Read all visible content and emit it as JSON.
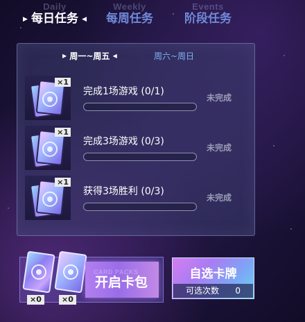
{
  "tabs": {
    "daily": {
      "label": "每日任务",
      "ghost": "Daily"
    },
    "weekly": {
      "label": "每周任务",
      "ghost": "Weekly"
    },
    "stage": {
      "label": "阶段任务",
      "ghost": "Events"
    }
  },
  "subtabs": {
    "weekday": "周一~周五",
    "weekend": "周六~周日"
  },
  "tasks": [
    {
      "name": "完成1场游戏 (0/1)",
      "reward_count": "×1",
      "status": "未完成",
      "progress": 0
    },
    {
      "name": "完成3场游戏 (0/3)",
      "reward_count": "×1",
      "status": "未完成",
      "progress": 0
    },
    {
      "name": "获得3场胜利 (0/3)",
      "reward_count": "×1",
      "status": "未完成",
      "progress": 0
    }
  ],
  "packs": {
    "open_label": "开启卡包",
    "ghost": "CARD PACKS",
    "count_a": "×0",
    "count_b": "×0"
  },
  "select": {
    "label": "自选卡牌",
    "remaining_label": "可选次数",
    "remaining_value": "0"
  },
  "colors": {
    "active_tab": "#ffffff",
    "inactive_tab": "#6f8ad8",
    "status_gray": "#9a9cb8",
    "progress_fill": "#6db5ff"
  }
}
